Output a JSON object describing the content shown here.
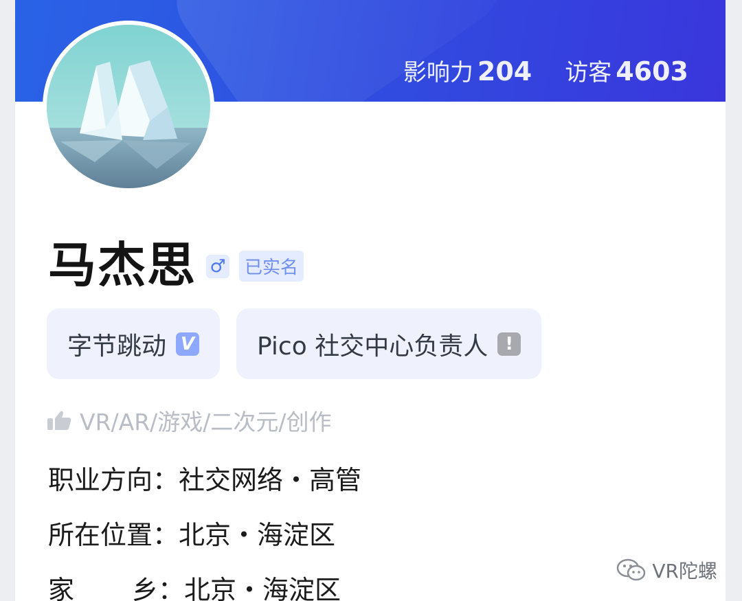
{
  "header": {
    "stats": [
      {
        "label": "影响力",
        "value": "204"
      },
      {
        "label": "访客",
        "value": "4603"
      }
    ]
  },
  "profile": {
    "name": "马杰思",
    "gender_icon": "male-symbol-icon",
    "gender_symbol": "♂",
    "verified_label": "已实名",
    "tags": [
      {
        "label": "字节跳动",
        "icon": "verified-check-icon",
        "symbol": "V"
      },
      {
        "label": "Pico 社交中心负责人",
        "icon": "alert-icon",
        "symbol": "!"
      }
    ],
    "interests": "VR/AR/游戏/二次元/创作",
    "info": [
      {
        "label": "职业方向：",
        "value": "社交网络・高管"
      },
      {
        "label": "所在位置：",
        "value": "北京・海淀区"
      },
      {
        "label_start": "家",
        "label_end": "乡：",
        "value": "北京・海淀区"
      }
    ]
  },
  "watermark": {
    "text": "VR陀螺"
  },
  "colors": {
    "banner_start": "#2a63e6",
    "banner_end": "#3a36dc",
    "tag_bg": "#eff2fc",
    "badge_bg": "#e6ecff"
  }
}
